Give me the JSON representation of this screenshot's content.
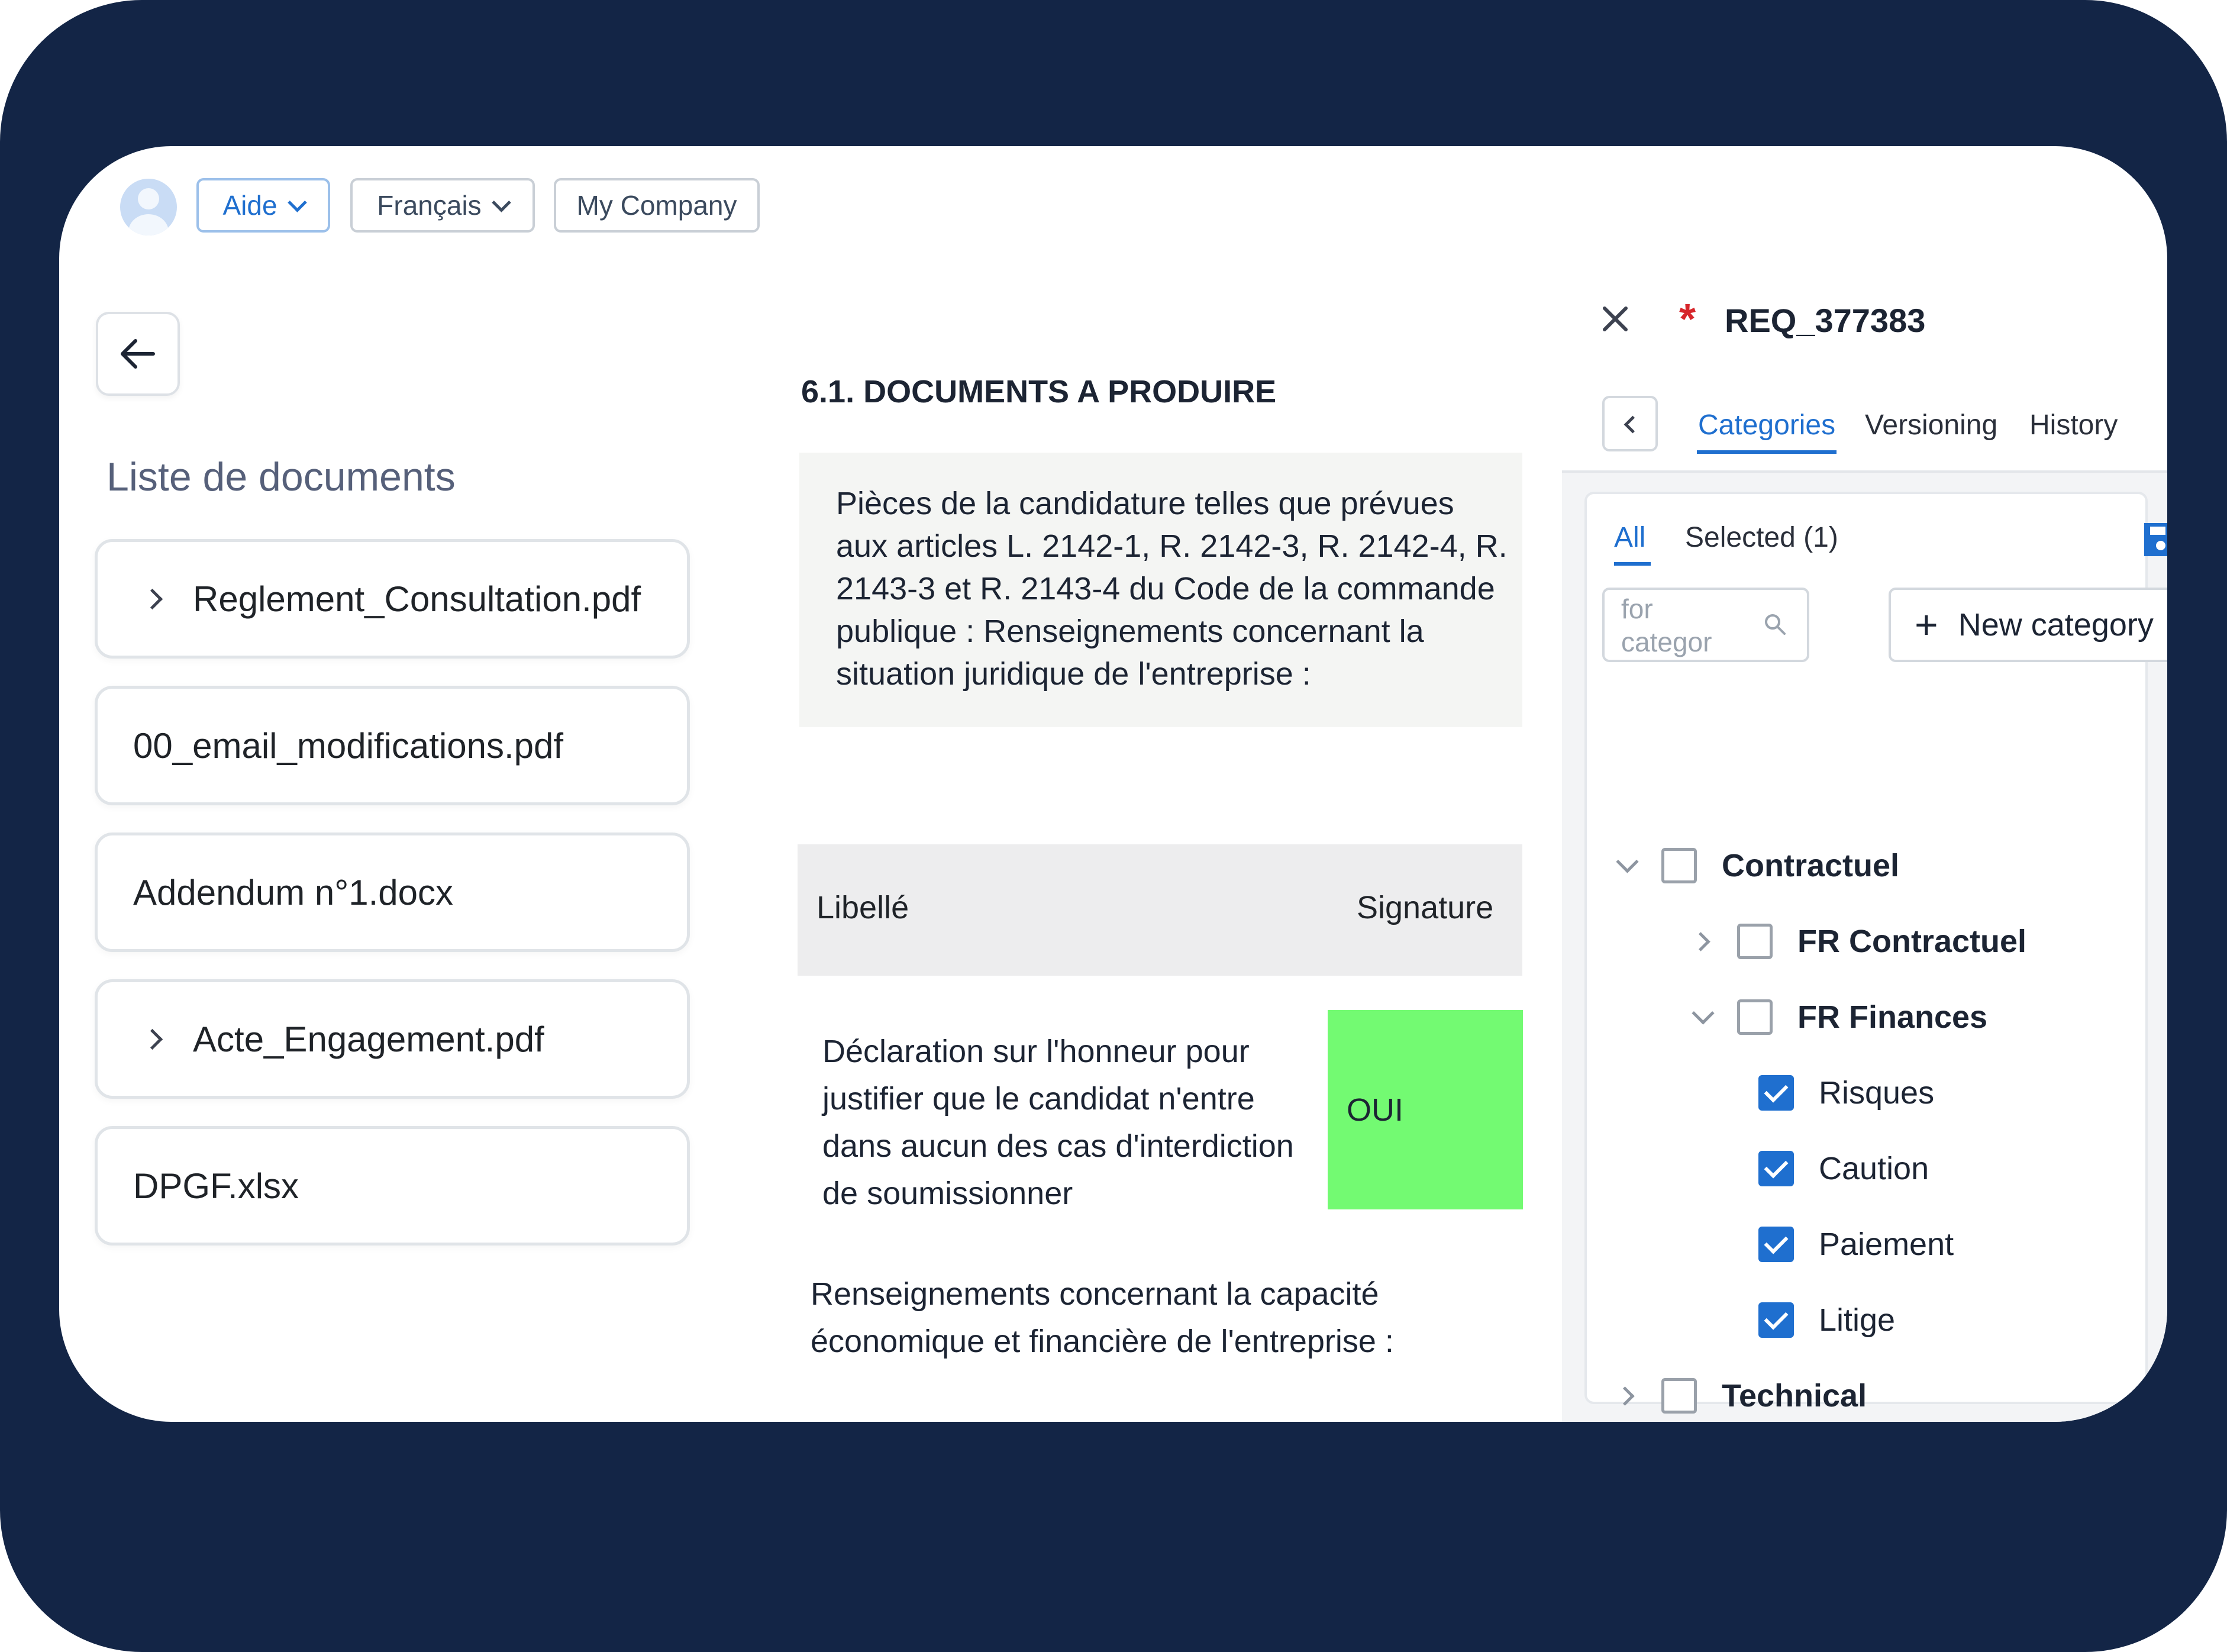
{
  "topbar": {
    "help_label": "Aide",
    "language_label": "Français",
    "company_label": "My Company"
  },
  "documents": {
    "title": "Liste de documents",
    "items": [
      {
        "name": "Reglement_Consultation.pdf",
        "expandable": true
      },
      {
        "name": "00_email_modifications.pdf",
        "expandable": false
      },
      {
        "name": "Addendum n°1.docx",
        "expandable": false
      },
      {
        "name": "Acte_Engagement.pdf",
        "expandable": true
      },
      {
        "name": "DPGF.xlsx",
        "expandable": false
      }
    ]
  },
  "content": {
    "section_title": "6.1. DOCUMENTS A PRODUIRE",
    "quote_lines": [
      "Pièces de la candidature telles que prévues",
      "aux articles L. 2142-1, R. 2142-3, R. 2142-4, R.",
      "2143-3 et R. 2143-4 du Code de la commande",
      "publique : Renseignements concernant la",
      "situation juridique de l'entreprise :"
    ],
    "table_headers": {
      "label": "Libellé",
      "signature": "Signature"
    },
    "row1_lines": [
      "Déclaration sur l'honneur pour",
      "justifier que le candidat n'entre",
      "dans aucun des cas d'interdiction",
      "de soumissionner"
    ],
    "row1_signature": "OUI",
    "row1_signature_color": "#73fa72",
    "row2_lines": [
      "Renseignements concernant la capacité",
      "économique et financière de l'entreprise :"
    ]
  },
  "panel": {
    "required_marker": "*",
    "requirement_id": "REQ_377383",
    "tabs": [
      "Categories",
      "Versioning",
      "History"
    ],
    "active_tab": "Categories",
    "subtabs": [
      "All",
      "Selected (1)"
    ],
    "active_subtab": "All",
    "search_placeholder": "for categor",
    "new_category_label": "New category",
    "tree": [
      {
        "label": "Contractuel",
        "checked": false,
        "expanded": true,
        "level": 0
      },
      {
        "label": "FR Contractuel",
        "checked": false,
        "expanded": false,
        "level": 1
      },
      {
        "label": "FR Finances",
        "checked": false,
        "expanded": true,
        "level": 1
      },
      {
        "label": "Risques",
        "checked": true,
        "level": 2
      },
      {
        "label": "Caution",
        "checked": true,
        "level": 2
      },
      {
        "label": "Paiement",
        "checked": true,
        "level": 2
      },
      {
        "label": "Litige",
        "checked": true,
        "level": 2
      },
      {
        "label": "Technical",
        "checked": false,
        "expanded": false,
        "level": 0
      }
    ]
  },
  "colors": {
    "accent": "#1f6fcf",
    "frame": "#132546",
    "required": "#d7262b"
  }
}
